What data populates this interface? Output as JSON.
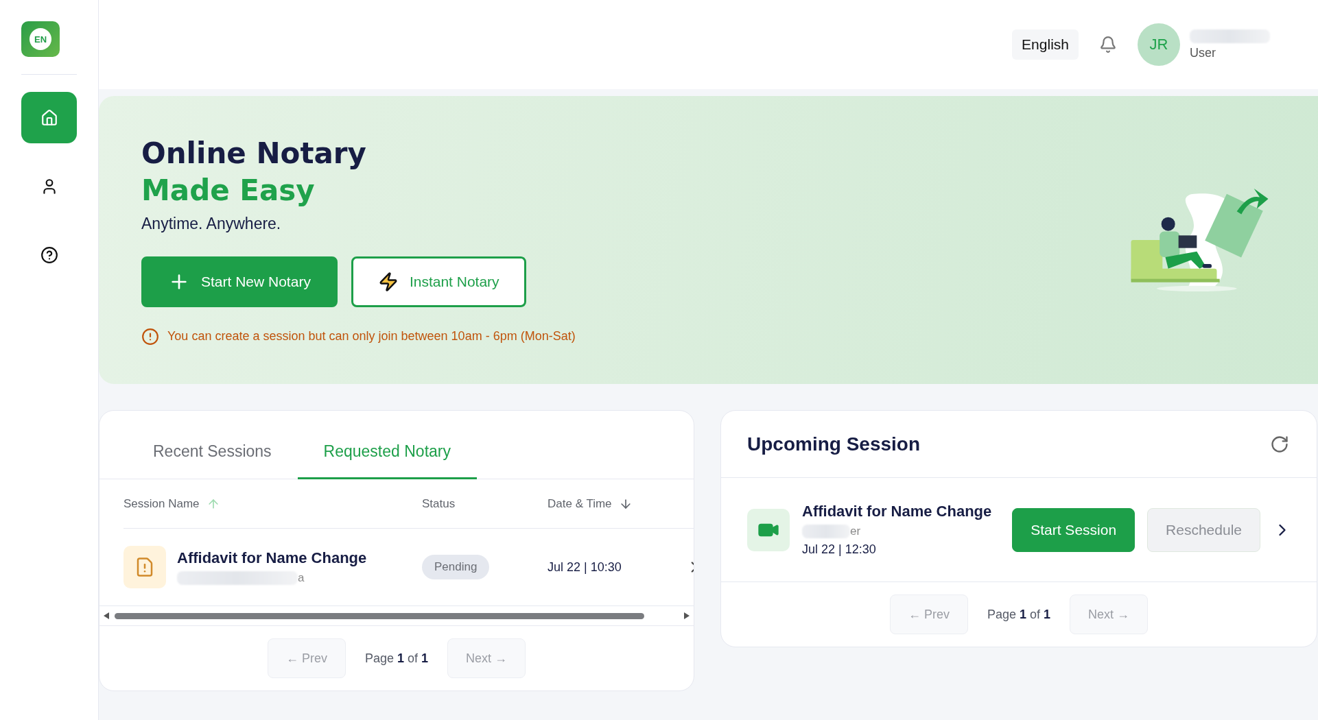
{
  "sidebar": {
    "logo": "EN",
    "items": [
      {
        "kind": "home",
        "selected": true
      },
      {
        "kind": "profile",
        "selected": false
      },
      {
        "kind": "help",
        "selected": false
      }
    ]
  },
  "header": {
    "language": "English",
    "user": {
      "initials": "JR",
      "role": "User"
    }
  },
  "banner": {
    "title": "Online Notary",
    "highlight": "Made Easy",
    "tagline": "Anytime. Anywhere.",
    "buttons": [
      {
        "kind": "primary",
        "label": "Start New Notary"
      },
      {
        "kind": "outline",
        "label": "Instant Notary"
      }
    ],
    "notice": "You can create a session but can only join between 10am - 6pm (Mon-Sat)"
  },
  "sessions": {
    "tabs": [
      {
        "label": "Recent Sessions",
        "selected": false
      },
      {
        "label": "Requested Notary",
        "selected": true
      }
    ],
    "columns": [
      {
        "label": "Session Name",
        "ascending": true
      },
      {
        "label": "Status"
      },
      {
        "label": "Date & Time",
        "ascending": false
      }
    ],
    "rows": [
      {
        "name": "Affidavit for Name Change",
        "subtitle": "a",
        "status": "Pending",
        "datetime": "Jul 22 | 10:30"
      }
    ],
    "pagination": {
      "prev": {
        "label": "← Prev",
        "disabled": true
      },
      "page": "Page **1** of **1**",
      "next": {
        "label": "Next →",
        "disabled": true
      }
    }
  },
  "upcoming": {
    "title": "Upcoming Session",
    "items": [
      {
        "name": "Affidavit for Name Change",
        "subtitle": "er",
        "datetime": "Jul 22 | 12:30",
        "actions": [
          {
            "kind": "primary",
            "label": "Start Session"
          },
          {
            "kind": "muted",
            "label": "Reschedule"
          }
        ]
      }
    ],
    "pagination": {
      "prev": {
        "label": "← Prev",
        "disabled": true
      },
      "page": "Page **1** of **1**",
      "next": {
        "label": "Next →",
        "disabled": true
      }
    }
  }
}
